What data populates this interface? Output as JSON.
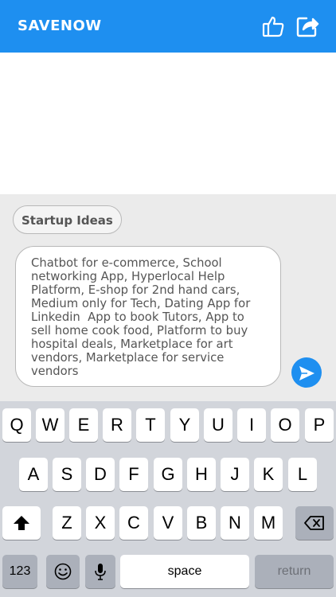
{
  "header": {
    "title": "SAVENOW",
    "icons": [
      "thumbs-up-icon",
      "share-icon"
    ],
    "bg_color": "#1e8ff0"
  },
  "chat": {
    "tag_label": "Startup Ideas",
    "message_lines": [
      "Chatbot for e-commerce, School",
      "networking App, Hyperlocal Help",
      "Platform, E-shop for 2nd hand cars,",
      "Medium only for Tech, Dating App for",
      "Linkedin  App to book Tutors, App to",
      "sell home cook food, Platform to buy",
      "hospital deals, Marketplace for art",
      "vendors, Marketplace for service",
      "vendors"
    ],
    "send_icon": "send-icon"
  },
  "keyboard": {
    "row1": [
      "Q",
      "W",
      "E",
      "R",
      "T",
      "Y",
      "U",
      "I",
      "O",
      "P"
    ],
    "row2": [
      "A",
      "S",
      "D",
      "F",
      "G",
      "H",
      "J",
      "K",
      "L"
    ],
    "row3": [
      "Z",
      "X",
      "C",
      "V",
      "B",
      "N",
      "M"
    ],
    "numbers_label": "123",
    "space_label": "space",
    "return_label": "return",
    "shift_icon": "shift-icon",
    "delete_icon": "delete-icon",
    "emoji_icon": "emoji-icon",
    "mic_icon": "microphone-icon"
  }
}
